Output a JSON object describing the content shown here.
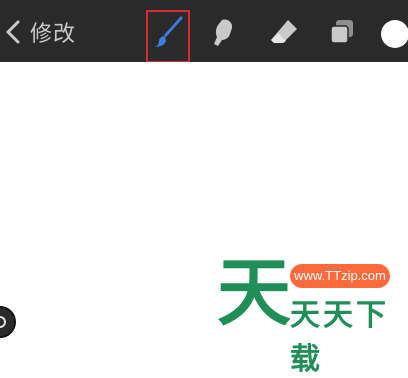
{
  "toolbar": {
    "back_label": "修改",
    "tools": {
      "brush": "brush-icon",
      "smudge": "smudge-icon",
      "eraser": "eraser-icon",
      "layers": "layers-icon"
    },
    "selected_tool": "brush",
    "current_color": "#ffffff",
    "brush_accent": "#3b7de0",
    "highlight_color": "#d32f2f"
  },
  "watermark": {
    "glyph": "天",
    "url": "www.TTzip.com",
    "text": "天天下载",
    "green": "#1f8e57",
    "orange": "#ff6a3c"
  }
}
